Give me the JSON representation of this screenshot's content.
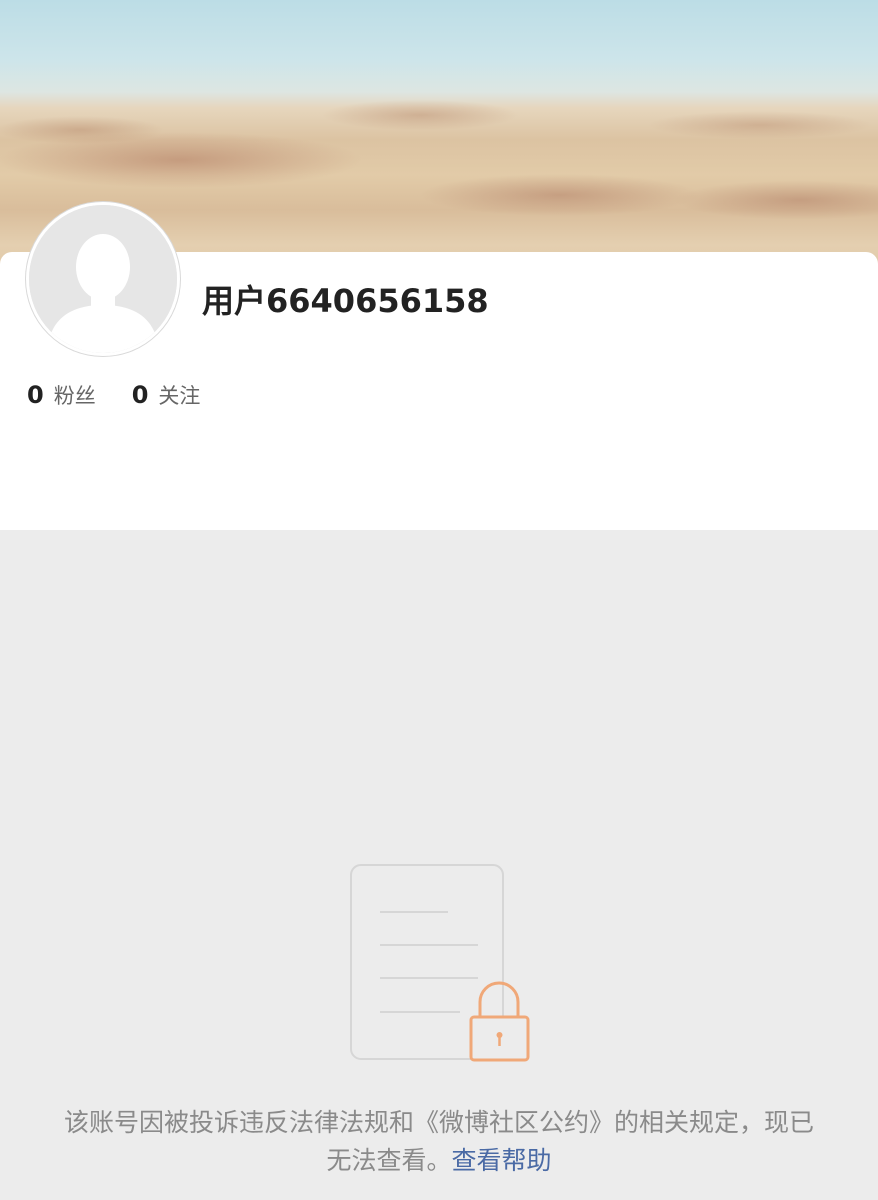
{
  "profile": {
    "username": "用户6640656158",
    "stats": [
      {
        "count": "0",
        "label": "粉丝"
      },
      {
        "count": "0",
        "label": "关注"
      }
    ]
  },
  "notice": {
    "message": "该账号因被投诉违反法律法规和《微博社区公约》的相关规定，现已无法查看。",
    "help_link": "查看帮助"
  },
  "icons": {
    "avatar": "default-avatar-icon",
    "locked_document": "locked-document-icon"
  },
  "colors": {
    "link": "#4a6aa5",
    "lock_accent": "#f0a878"
  }
}
